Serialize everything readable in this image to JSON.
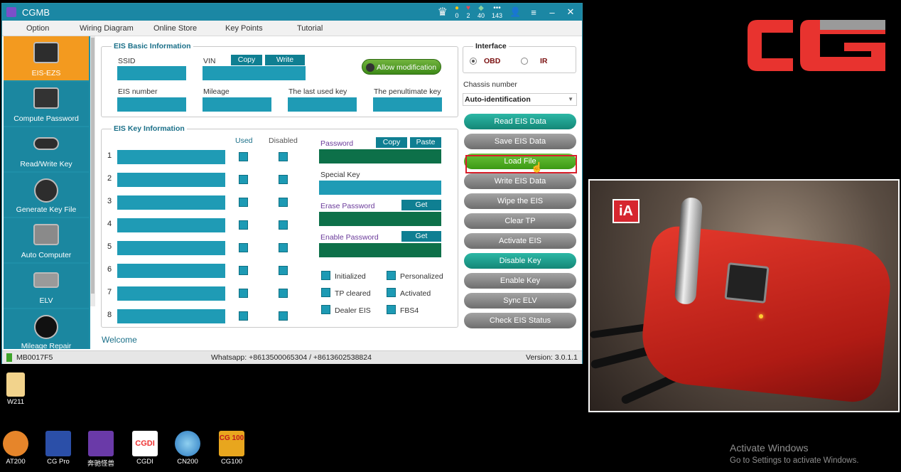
{
  "window": {
    "title": "CGMB",
    "stats": [
      "0",
      "2",
      "40",
      "143"
    ],
    "menu": [
      "Option",
      "Wiring Diagram",
      "Online Store",
      "Key Points",
      "Tutorial"
    ]
  },
  "sidebar": {
    "items": [
      {
        "label": "EIS-EZS"
      },
      {
        "label": "Compute Password"
      },
      {
        "label": "Read/Write Key"
      },
      {
        "label": "Generate Key File"
      },
      {
        "label": "Auto Computer"
      },
      {
        "label": "ELV"
      },
      {
        "label": "Mileage Repair"
      }
    ]
  },
  "eis_basic": {
    "title": "EIS Basic Information",
    "ssid_label": "SSID",
    "vin_label": "VIN",
    "copy": "Copy",
    "write": "Write",
    "allow": "Allow modification",
    "eis_number_label": "EIS number",
    "mileage_label": "Mileage",
    "last_key_label": "The last used key",
    "penultimate_label": "The penultimate key"
  },
  "eis_key": {
    "title": "EIS Key Information",
    "used_label": "Used",
    "disabled_label": "Disabled",
    "rows": [
      "1",
      "2",
      "3",
      "4",
      "5",
      "6",
      "7",
      "8"
    ],
    "password_label": "Password",
    "copy": "Copy",
    "paste": "Paste",
    "special_key_label": "Special Key",
    "erase_password_label": "Erase Password",
    "enable_password_label": "Enable Password",
    "get": "Get",
    "flags": [
      "Initialized",
      "Personalized",
      "TP cleared",
      "Activated",
      "Dealer EIS",
      "FBS4"
    ]
  },
  "interface": {
    "title": "Interface",
    "obd": "OBD",
    "ir": "IR",
    "chassis_label": "Chassis number",
    "chassis_value": "Auto-identification"
  },
  "actions": [
    "Read EIS Data",
    "Save EIS Data",
    "Load File",
    "Write EIS Data",
    "Wipe the EIS",
    "Clear TP",
    "Activate EIS",
    "Disable Key",
    "Enable Key",
    "Sync ELV",
    "Check EIS Status"
  ],
  "welcome": "Welcome",
  "status": {
    "device": "MB0017F5",
    "contact": "Whatsapp: +8613500065304 / +8613602538824",
    "version": "Version: 3.0.1.1"
  },
  "desktop": {
    "folder": "W211",
    "taskbar_icons": [
      "AT200",
      "CG Pro",
      "奔驰怪兽",
      "CGDI",
      "CN200",
      "CG100"
    ],
    "activate_title": "Activate Windows",
    "activate_sub": "Go to Settings to activate Windows.",
    "cg100_text": "CG 100",
    "cgdi_text": "CGDI",
    "photo_badge": "iA"
  }
}
